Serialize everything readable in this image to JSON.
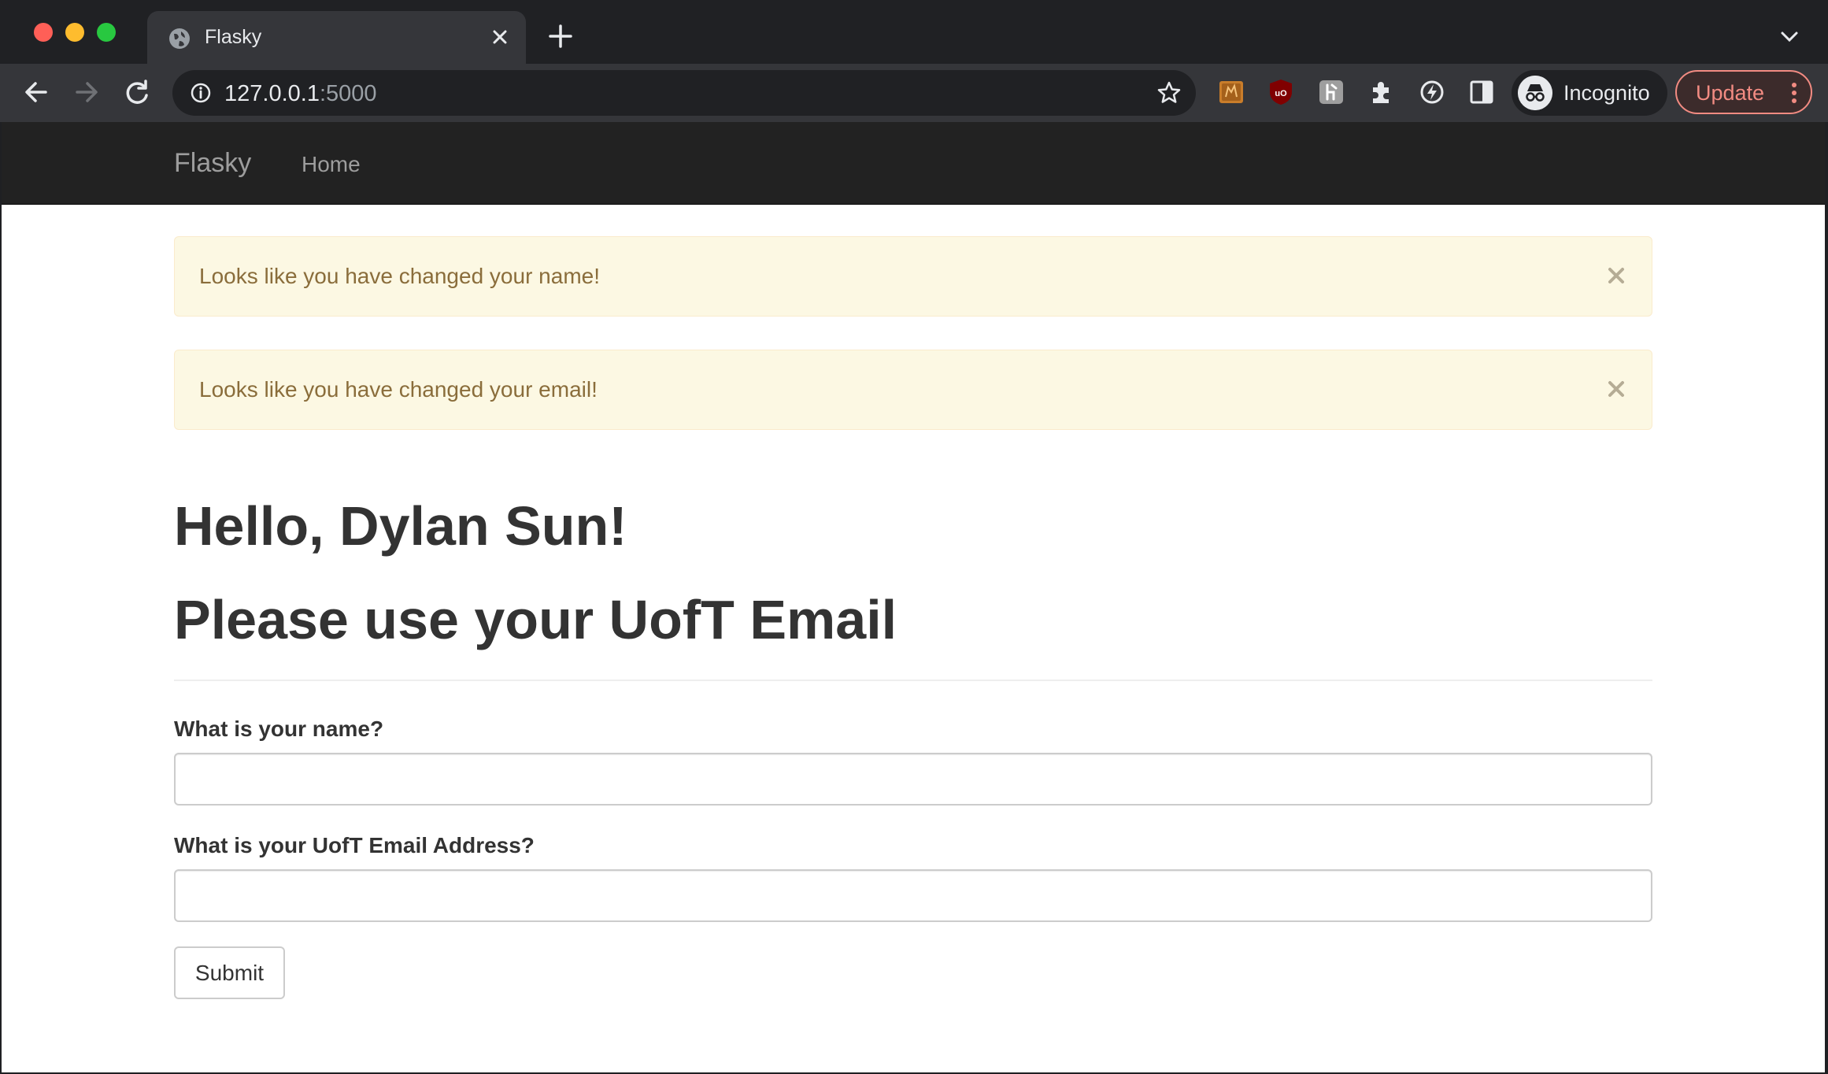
{
  "browser": {
    "tab_title": "Flasky",
    "url_host": "127.0.0.1",
    "url_port": ":5000",
    "profile_label": "Incognito",
    "update_label": "Update"
  },
  "navbar": {
    "brand": "Flasky",
    "home": "Home"
  },
  "alerts": [
    {
      "text": "Looks like you have changed your name!"
    },
    {
      "text": "Looks like you have changed your email!"
    }
  ],
  "main": {
    "greeting": "Hello, Dylan Sun!",
    "subtitle": "Please use your UofT Email"
  },
  "form": {
    "name_label": "What is your name?",
    "name_value": "",
    "email_label": "What is your UofT Email Address?",
    "email_value": "",
    "submit_label": "Submit"
  },
  "colors": {
    "alert_bg": "#fcf8e3",
    "alert_text": "#8a6d3b",
    "navbar_bg": "#222222",
    "update_accent": "#f28b82"
  }
}
